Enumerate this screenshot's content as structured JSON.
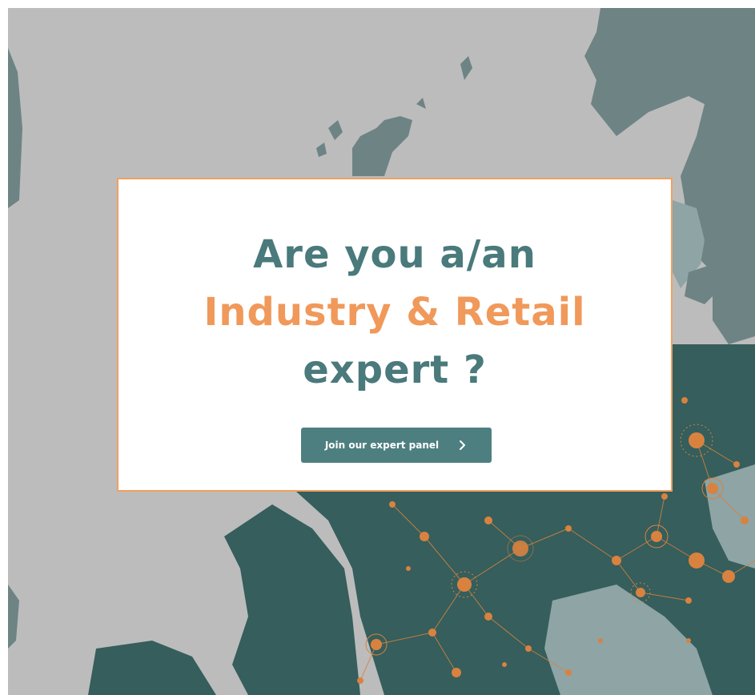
{
  "popup": {
    "line1": "Are you a/an",
    "line2": "Industry & Retail",
    "line3": "expert ?",
    "button_label": "Join our expert panel"
  },
  "icons": {
    "button_icon": "chevron-right-icon"
  },
  "colors": {
    "background_gray": "#bcbcbc",
    "land_slate": "#6e8384",
    "land_dark_teal": "#355e5c",
    "land_light": "#8ea4a5",
    "accent_orange": "#f0995a",
    "heading_teal": "#4a7a7b",
    "button_teal": "#4e7f80",
    "card_border": "#f0a060"
  }
}
